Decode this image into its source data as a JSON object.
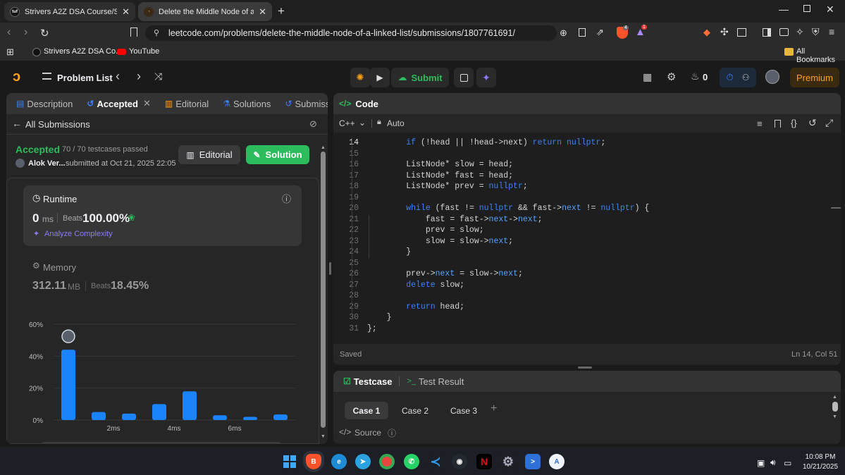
{
  "browser": {
    "tabs": [
      {
        "title": "Strivers A2Z DSA Course/Sheet -",
        "icon": "tuf-favicon-icon"
      },
      {
        "title": "Delete the Middle Node of a Lin",
        "icon": "leetcode-favicon-icon"
      }
    ],
    "url": "leetcode.com/problems/delete-the-middle-node-of-a-linked-list/submissions/1807761691/",
    "shield_count": "4",
    "alert_count": "1",
    "bookmarks": [
      "Strivers A2Z DSA Co...",
      "YouTube"
    ],
    "all_bookmarks": "All Bookmarks"
  },
  "nav": {
    "problem_list": "Problem List",
    "submit": "Submit",
    "streak": "0",
    "premium": "Premium"
  },
  "left": {
    "tabs": [
      "Description",
      "Accepted",
      "Editorial",
      "Solutions",
      "Submissions"
    ],
    "all_submissions": "All Submissions",
    "status": "Accepted",
    "testcases": "70 / 70 testcases passed",
    "user": "Alok Ver...",
    "submitted_at": "submitted at Oct 21, 2025 22:05",
    "editorial_btn": "Editorial",
    "solution_btn": "Solution",
    "runtime": {
      "label": "Runtime",
      "value": "0",
      "unit": "ms",
      "beats_label": "Beats",
      "beats": "100.00%",
      "analyze": "Analyze Complexity"
    },
    "memory": {
      "label": "Memory",
      "value": "312.11",
      "unit": "MB",
      "beats_label": "Beats",
      "beats": "18.45%"
    }
  },
  "chart_data": {
    "type": "bar",
    "y_tick_labels": [
      "60%",
      "40%",
      "20%",
      "0%"
    ],
    "x_tick_labels": [
      "2ms",
      "4ms",
      "6ms"
    ],
    "ylim": [
      0,
      60
    ],
    "values": [
      44,
      5,
      4,
      10,
      18,
      3,
      2,
      3.5
    ],
    "highlight_index": 0,
    "bar_color": "#1a84ff",
    "grid": true
  },
  "code": {
    "title": "Code",
    "language": "C++",
    "mode": "Auto",
    "status": "Saved",
    "cursor": "Ln 14, Col 51",
    "line_numbers": [
      "14",
      "15",
      "16",
      "17",
      "18",
      "19",
      "20",
      "21",
      "22",
      "23",
      "24",
      "25",
      "26",
      "27",
      "28",
      "29",
      "30",
      "31"
    ],
    "lines": [
      [
        [
          "        ",
          "p"
        ],
        [
          "if",
          "k"
        ],
        [
          " (!head || !head->next) ",
          "p"
        ],
        [
          "return",
          "k"
        ],
        [
          " ",
          "p"
        ],
        [
          "nullptr",
          "c"
        ],
        [
          ";",
          "p"
        ]
      ],
      [
        [
          "",
          "p"
        ]
      ],
      [
        [
          "        ListNode* slow = head;",
          "p"
        ]
      ],
      [
        [
          "        ListNode* fast = head;",
          "p"
        ]
      ],
      [
        [
          "        ListNode* prev = ",
          "p"
        ],
        [
          "nullptr",
          "c"
        ],
        [
          ";",
          "p"
        ]
      ],
      [
        [
          "",
          "p"
        ]
      ],
      [
        [
          "        ",
          "p"
        ],
        [
          "while",
          "k"
        ],
        [
          " (fast != ",
          "p"
        ],
        [
          "nullptr",
          "c"
        ],
        [
          " && ",
          "p"
        ],
        [
          "fast",
          "p"
        ],
        [
          "->",
          "p"
        ],
        [
          "next",
          "f"
        ],
        [
          " != ",
          "p"
        ],
        [
          "nullptr",
          "c"
        ],
        [
          ") {",
          "p"
        ]
      ],
      [
        [
          "            fast = ",
          "p"
        ],
        [
          "fast",
          "p"
        ],
        [
          "->",
          "p"
        ],
        [
          "next",
          "f"
        ],
        [
          "->",
          "p"
        ],
        [
          "next",
          "f"
        ],
        [
          ";",
          "p"
        ]
      ],
      [
        [
          "            prev = slow;",
          "p"
        ]
      ],
      [
        [
          "            slow = ",
          "p"
        ],
        [
          "slow",
          "p"
        ],
        [
          "->",
          "p"
        ],
        [
          "next",
          "f"
        ],
        [
          ";",
          "p"
        ]
      ],
      [
        [
          "        }",
          "p"
        ]
      ],
      [
        [
          "",
          "p"
        ]
      ],
      [
        [
          "        prev->",
          "p"
        ],
        [
          "next",
          "f"
        ],
        [
          " = slow->",
          "p"
        ],
        [
          "next",
          "f"
        ],
        [
          ";",
          "p"
        ]
      ],
      [
        [
          "        ",
          "p"
        ],
        [
          "delete",
          "k"
        ],
        [
          " slow;",
          "p"
        ]
      ],
      [
        [
          "",
          "p"
        ]
      ],
      [
        [
          "        ",
          "p"
        ],
        [
          "return",
          "k"
        ],
        [
          " head;",
          "p"
        ]
      ],
      [
        [
          "    }",
          "p"
        ]
      ],
      [
        [
          "};",
          "p"
        ]
      ]
    ]
  },
  "testcase": {
    "tab": "Testcase",
    "result_tab": "Test Result",
    "cases": [
      "Case 1",
      "Case 2",
      "Case 3"
    ],
    "source": "Source"
  },
  "taskbar": {
    "time": "10:08 PM",
    "date": "10/21/2025"
  }
}
